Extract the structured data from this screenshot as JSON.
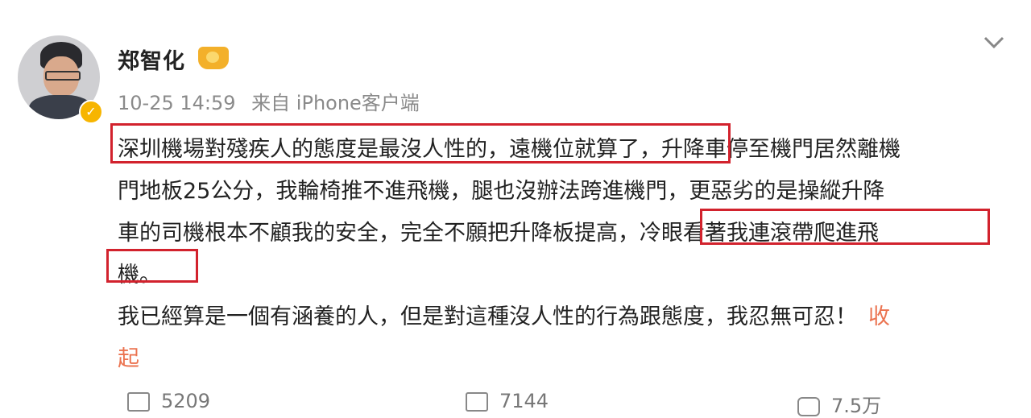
{
  "post": {
    "author": "郑智化",
    "time": "10-25 14:59",
    "source": "来自 iPhone客户端",
    "lines": [
      "深圳機場對殘疾人的態度是最沒人性的，遠機位就算了，升降車停至機門居然離機",
      "門地板25公分，我輪椅推不進飛機，腿也沒辦法跨進機門，更惡劣的是操縱升降",
      "車的司機根本不顧我的安全，完全不願把升降板提高，冷眼看著我連滾帶爬進飛",
      "機。",
      "我已經算是一個有涵養的人，但是對這種沒人性的行為跟態度，我忍無可忍！"
    ],
    "collapse_part1": "收",
    "collapse_part2": "起"
  },
  "actions": {
    "repost_count": "5209",
    "comment_count": "7144",
    "like_count": "7.5万"
  },
  "icons": {
    "verified": "verified-badge-icon",
    "vip": "crown-icon",
    "menu": "chevron-down-icon"
  },
  "colors": {
    "highlight_box": "#d2222d",
    "collapse_link": "#eb7350",
    "verified": "#f7b500"
  }
}
